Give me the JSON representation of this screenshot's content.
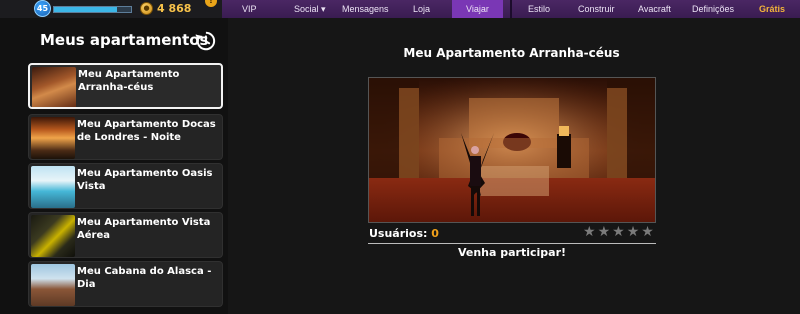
{
  "status": {
    "level": "45",
    "xp_fraction": 0.82,
    "coins": "4 868",
    "alert": "!"
  },
  "nav": {
    "vip": "VIP",
    "social": "Social",
    "mensagens": "Mensagens",
    "loja": "Loja",
    "viajar": "Viajar",
    "estilo": "Estilo",
    "construir": "Construir",
    "avacraft": "Avacraft",
    "definicoes": "Definições",
    "gratis": "Grátis"
  },
  "sidebar": {
    "title": "Meus apartamentos",
    "items": [
      {
        "label": "Meu Apartamento Arranha-céus"
      },
      {
        "label": "Meu Apartamento Docas de Londres - Noite"
      },
      {
        "label": "Meu Apartamento Oasis Vista"
      },
      {
        "label": "Meu Apartamento Vista Aérea"
      },
      {
        "label": "Meu Cabana do Alasca - Dia"
      }
    ]
  },
  "main": {
    "title": "Meu Apartamento Arranha-céus",
    "users_label": "Usuários:",
    "users_count": "0",
    "rating_stars": 0,
    "rating_max": 5,
    "join_text": "Venha participar!"
  },
  "colors": {
    "nav_active": "#7a37b5",
    "gratis": "#f3b43a",
    "coins": "#f7c24a",
    "users_count": "#f2a11a"
  }
}
